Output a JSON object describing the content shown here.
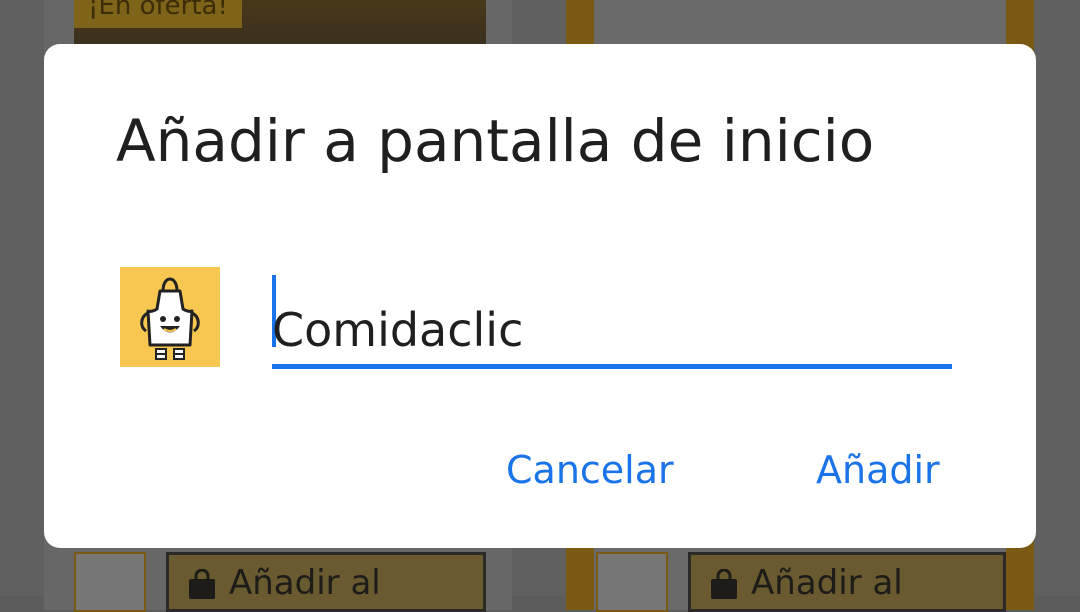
{
  "background": {
    "sale_badge": "¡En oferta!",
    "add_to_cart_label": "Añadir al"
  },
  "dialog": {
    "title": "Añadir a pantalla de inicio",
    "name_input_value": "Comidaclic",
    "cancel_label": "Cancelar",
    "add_label": "Añadir"
  },
  "colors": {
    "accent": "#1a73e8",
    "icon_background": "#f7c752"
  },
  "icons": [
    "apron-app-icon",
    "shopping-bag-icon"
  ]
}
